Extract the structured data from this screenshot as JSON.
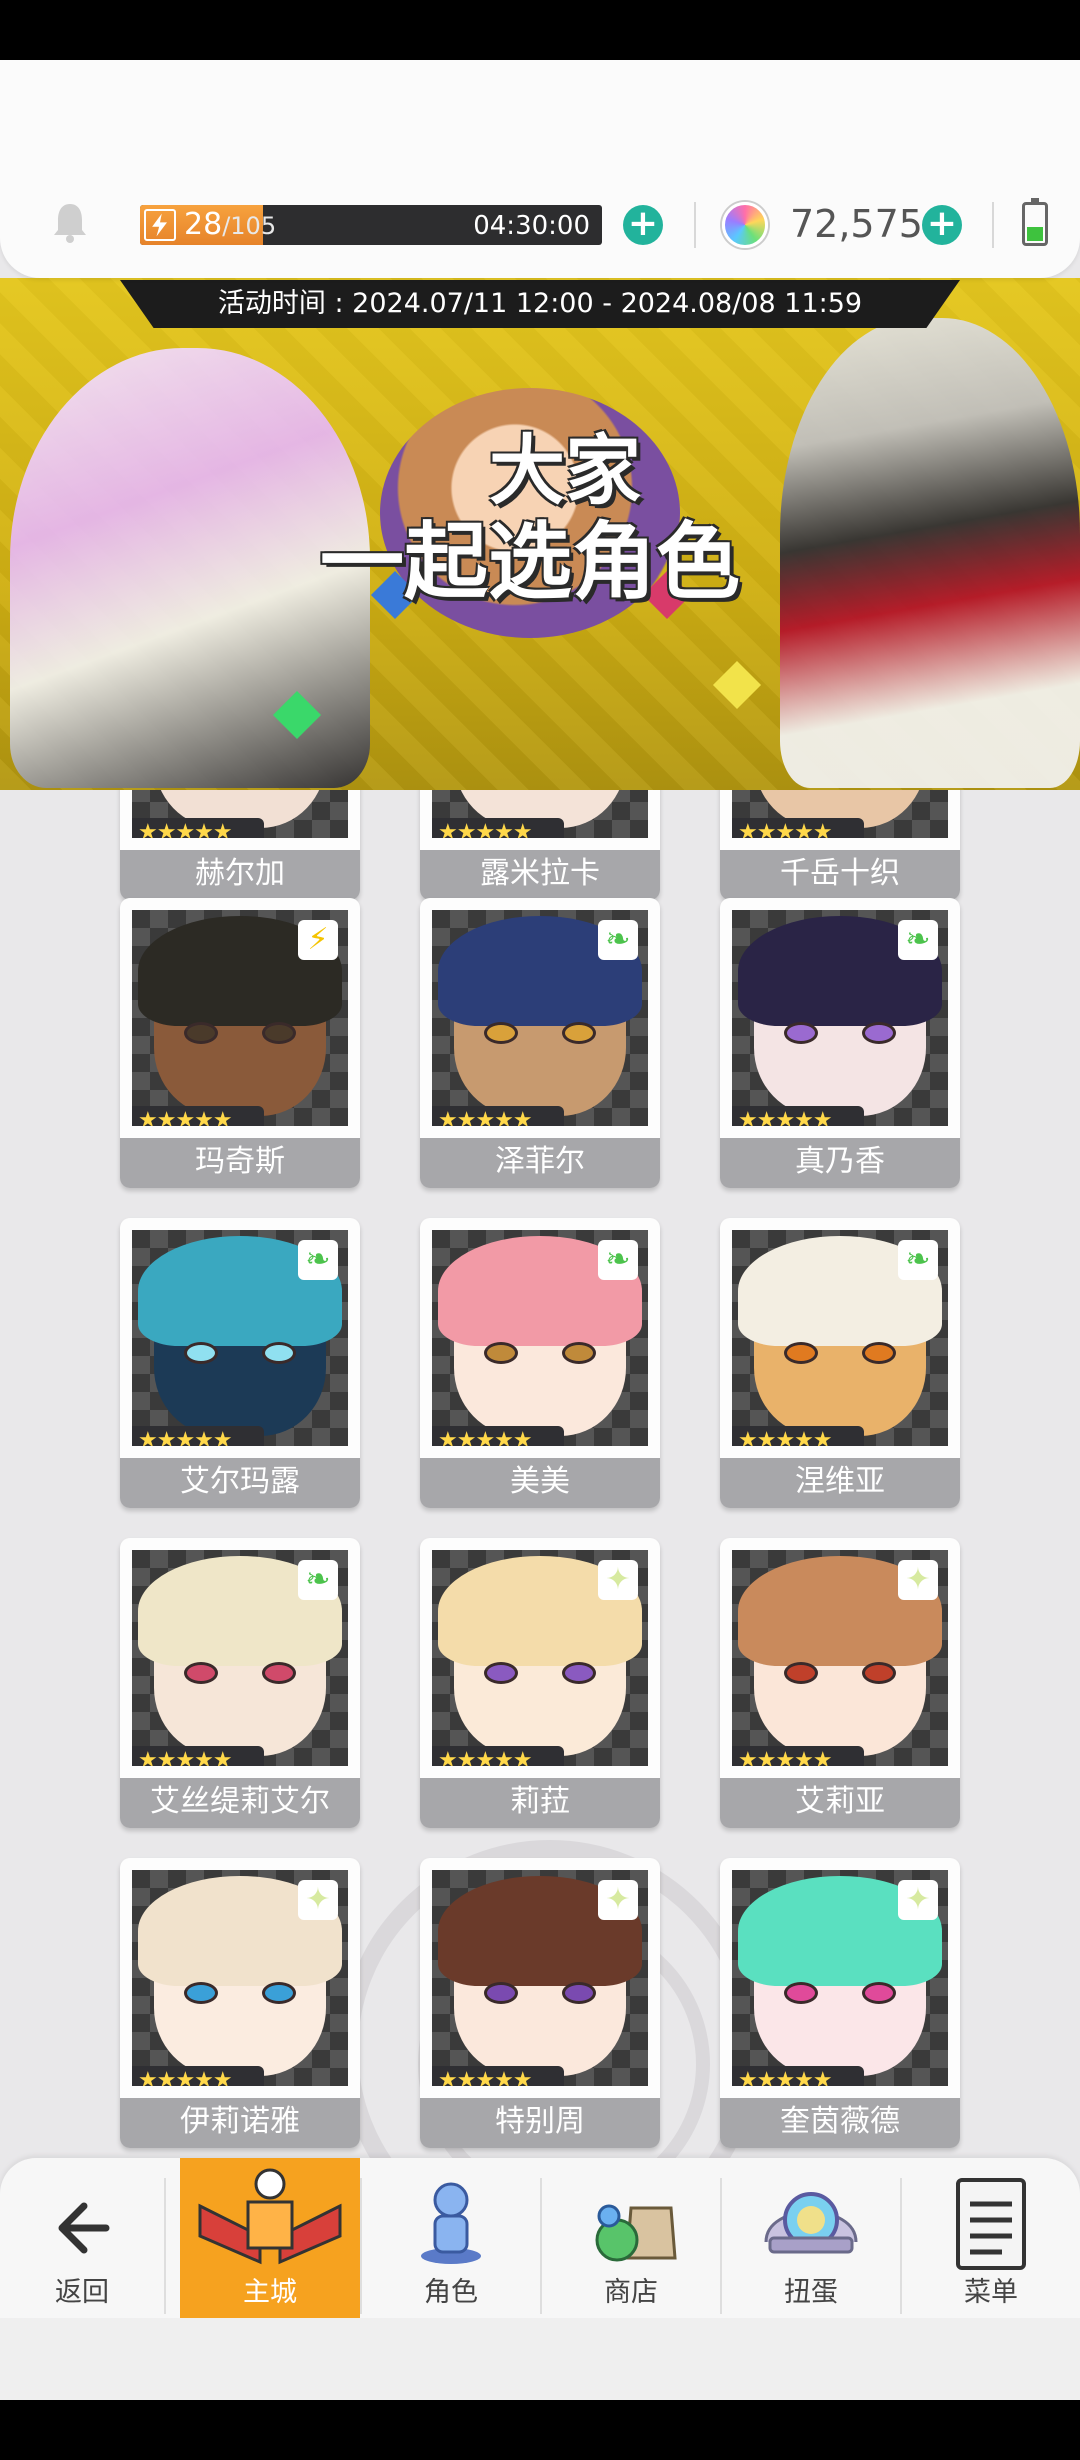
{
  "header": {
    "energy_current": "28",
    "energy_max": "105",
    "energy_fraction": 0.267,
    "energy_timer": "04:30:00",
    "gem_count": "72,575"
  },
  "banner": {
    "event_time": "活动时间 : 2024.07/11 12:00 - 2024.08/08 11:59",
    "title_line1": "大家",
    "title_line2": "一起选角色"
  },
  "characters": [
    {
      "name": "赫尔加",
      "stars": "★★★★★",
      "element": "",
      "hair": "#f0eeea",
      "skin": "#f2e0d4",
      "eye": "#8a8a8a"
    },
    {
      "name": "露米拉卡",
      "stars": "★★★★★",
      "element": "",
      "hair": "#2a2a30",
      "skin": "#f4e3d8",
      "eye": "#6a5a8a"
    },
    {
      "name": "千岳十织",
      "stars": "★★★★★",
      "element": "",
      "hair": "#d9d2c0",
      "skin": "#e8c6a6",
      "eye": "#6a4a3a"
    },
    {
      "name": "玛奇斯",
      "stars": "★★★★★",
      "element": "bolt",
      "hair": "#2c2a24",
      "skin": "#8a5a3a",
      "eye": "#4a3a2a"
    },
    {
      "name": "泽菲尔",
      "stars": "★★★★★",
      "element": "leaf",
      "hair": "#2c3e78",
      "skin": "#c79a6f",
      "eye": "#d9a13a"
    },
    {
      "name": "真乃香",
      "stars": "★★★★★",
      "element": "leaf",
      "hair": "#2a2446",
      "skin": "#f4e4e4",
      "eye": "#9a6ad0"
    },
    {
      "name": "艾尔玛露",
      "stars": "★★★★★",
      "element": "leaf",
      "hair": "#3aa8c0",
      "skin": "#1c3a56",
      "eye": "#90e0f0"
    },
    {
      "name": "美美",
      "stars": "★★★★★",
      "element": "leaf",
      "hair": "#f29aa6",
      "skin": "#fbe8dc",
      "eye": "#c08a3a"
    },
    {
      "name": "涅维亚",
      "stars": "★★★★★",
      "element": "leaf",
      "hair": "#f3eee2",
      "skin": "#e9b26a",
      "eye": "#e07a20"
    },
    {
      "name": "艾丝缇莉艾尔",
      "stars": "★★★★★",
      "element": "leaf",
      "hair": "#efe6c8",
      "skin": "#f6e6d8",
      "eye": "#d04a6a"
    },
    {
      "name": "莉菈",
      "stars": "★★★★★",
      "element": "sparkle",
      "hair": "#f4dcaa",
      "skin": "#fbead8",
      "eye": "#8a5ac0"
    },
    {
      "name": "艾莉亚",
      "stars": "★★★★★",
      "element": "sparkle",
      "hair": "#c98a5c",
      "skin": "#fbe6d8",
      "eye": "#c0402a"
    },
    {
      "name": "伊莉诺雅",
      "stars": "★★★★★",
      "element": "sparkle",
      "hair": "#f1e2cc",
      "skin": "#fbece0",
      "eye": "#3aa0d8"
    },
    {
      "name": "特别周",
      "stars": "★★★★★",
      "element": "sparkle",
      "hair": "#6a3a2a",
      "skin": "#fbe8dc",
      "eye": "#7a4ab0"
    },
    {
      "name": "奎茵薇德",
      "stars": "★★★★★",
      "element": "sparkle",
      "hair": "#5ae0c0",
      "skin": "#fbe6e8",
      "eye": "#e04a9a"
    }
  ],
  "nav": {
    "back": "返回",
    "home": "主城",
    "characters": "角色",
    "shop": "商店",
    "gacha": "扭蛋",
    "menu": "菜单"
  },
  "colors": {
    "accent_teal": "#22b39c",
    "energy_orange": "#f6a21f",
    "nav_active": "#f6a21f",
    "name_plate": "#a7a7aa",
    "element_wind": "#4cc34c",
    "element_light": "#f5c400",
    "element_star": "#d7eaa0"
  }
}
